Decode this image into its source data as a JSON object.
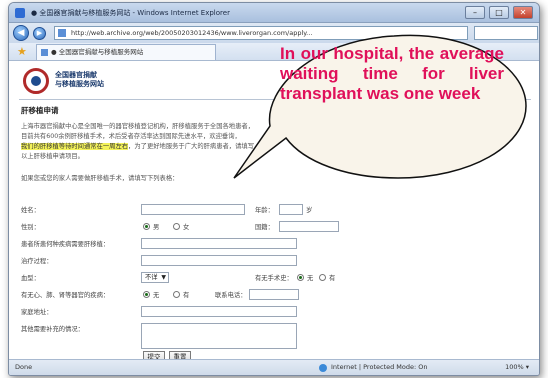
{
  "window": {
    "title": "● 全国器官捐献与移植服务网站 - Windows Internet Explorer",
    "minimize": "–",
    "maximize": "□",
    "close": "✕"
  },
  "addressbar": {
    "back": "◀",
    "forward": "▶",
    "url": "http://web.archive.org/web/20050203012436/www.liverorgan.com/apply..."
  },
  "tabbar": {
    "favorite_icon": "star-icon",
    "tab_label": "● 全国器官捐献与移植服务网站"
  },
  "page": {
    "logo_line1": "全国器官捐献",
    "logo_line2": "与移植服务网站",
    "section_title": "肝移植申请",
    "paragraph_lines": [
      "上海市器官捐献中心是全国唯一的器官移植登记机构，肝移植服务于全国各地患者，",
      "目前共有600余例肝移植手术，术后受者存活率达到国际先进水平，欢迎垂询，",
      "我们的肝移植等待时间通常在一周左右",
      "，为了更好地服务于广大的肝病患者，请填写",
      "以上肝移植申请项目。"
    ],
    "intro": "如果您或您的家人需要做肝移植手术，请填写下列表格："
  },
  "form": {
    "name_label": "姓名：",
    "age_label": "年龄：",
    "age_unit": "岁",
    "gender_label": "性别：",
    "gender_options": [
      "男",
      "女"
    ],
    "nationality_label": "国籍：",
    "diagnosis_label": "患者所患何种疾病需要肝移植：",
    "treatment_label": "治疗过程：",
    "blood_label": "血型：",
    "blood_value": "不详",
    "surgery_label": "有无手术史：",
    "surgery_options": [
      "无",
      "有"
    ],
    "other_disease_label": "有无心、肺、肾等器官的疾病：",
    "other_disease_options": [
      "无",
      "有"
    ],
    "phone_label": "联系电话：",
    "address_label": "家庭地址：",
    "notes_label": "其他需要补充的情况：",
    "submit_label": "提交",
    "reset_label": "重置"
  },
  "statusbar": {
    "left": "Done",
    "zone": "Internet | Protected Mode: On",
    "zoom": "100% ▾"
  },
  "callout": {
    "text": "In our hospital, the average waiting time for liver transplant was one week"
  },
  "colors": {
    "callout_text": "#e0105a",
    "highlight": "#f4f35a",
    "logo_ring": "#b02a2a"
  }
}
